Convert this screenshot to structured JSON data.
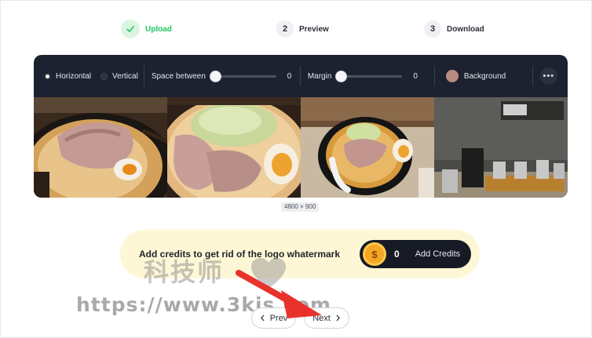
{
  "stepper": {
    "steps": [
      {
        "number": "✓",
        "label": "Upload",
        "state": "done"
      },
      {
        "number": "2",
        "label": "Preview",
        "state": "active"
      },
      {
        "number": "3",
        "label": "Download",
        "state": "pending"
      }
    ]
  },
  "toolbar": {
    "orientation": {
      "horizontal_label": "Horizontal",
      "vertical_label": "Vertical",
      "selected": "Horizontal"
    },
    "spacing": {
      "label": "Space between",
      "value": "0"
    },
    "margin": {
      "label": "Margin",
      "value": "0"
    },
    "background": {
      "label": "Background",
      "color": "#b98c82"
    },
    "more_icon": "more-horizontal-icon"
  },
  "canvas": {
    "dimensions": "4800 × 900",
    "photos": [
      "ramen-closeup-chashu",
      "ramen-bowl-egg",
      "ramen-bowl-topdown",
      "table-condiments"
    ]
  },
  "credits_banner": {
    "message": "Add credits to get rid of the logo whatermark",
    "coin_symbol": "$",
    "credit_count": "0",
    "add_label": "Add Credits"
  },
  "watermark": {
    "cn_text": "科技师",
    "url_text": "https://www.3kjs.com"
  },
  "pager": {
    "prev_label": "Prev",
    "next_label": "Next"
  },
  "colors": {
    "accent_green": "#22c55e",
    "toolbar_bg": "#1d2230",
    "banner_bg": "#fdf7d6",
    "annotation_red": "#e8322b"
  }
}
